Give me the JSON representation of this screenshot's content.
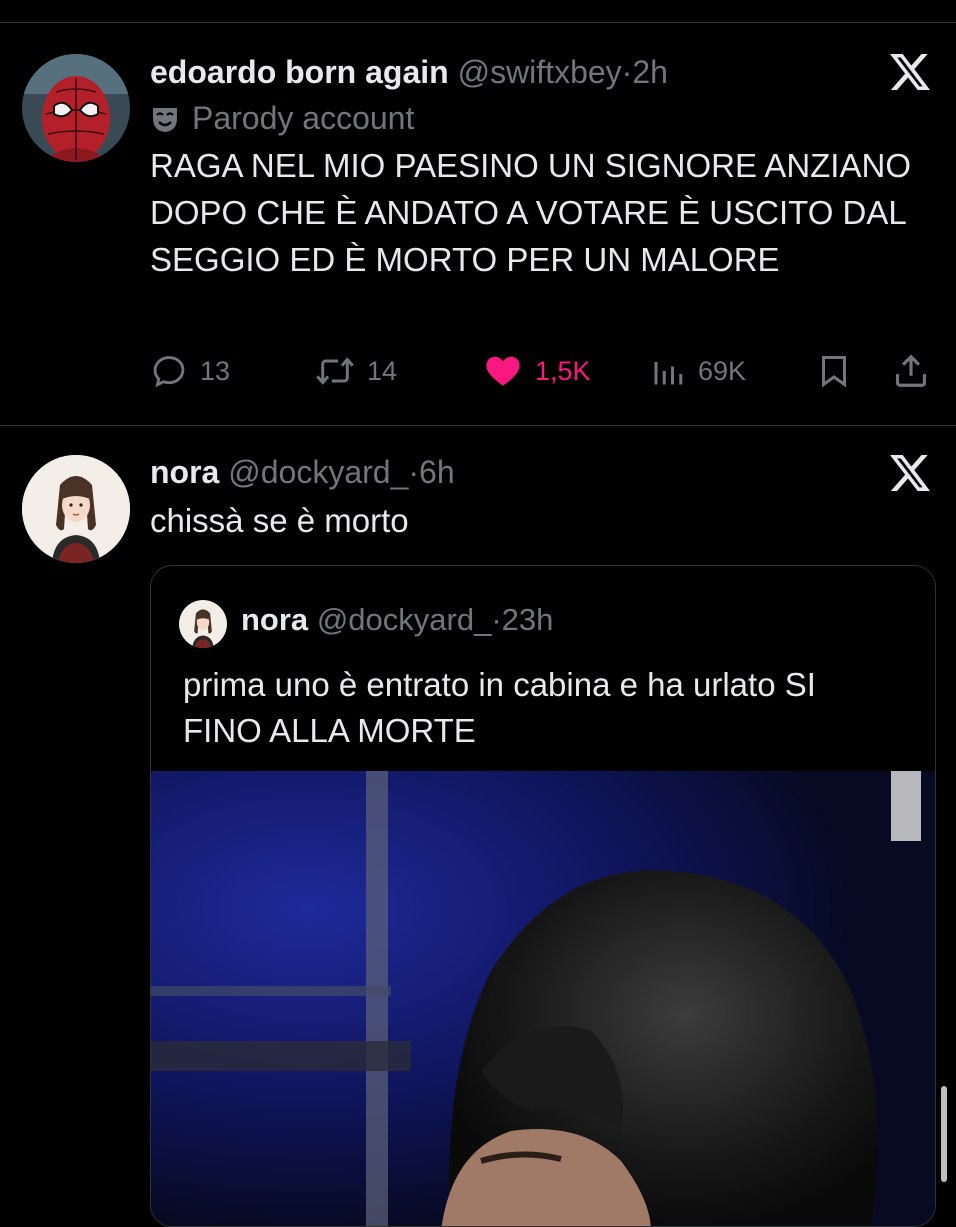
{
  "tweet1": {
    "display_name": "edoardo born again",
    "handle": "@swiftxbey",
    "dot": "·",
    "time": "2h",
    "label_icon": "theater-mask-icon",
    "label": "Parody account",
    "text": "RAGA NEL MIO PAESINO UN SIGNORE ANZIANO DOPO CHE È ANDATO A VOTARE È USCITO DAL SEGGIO ED È MORTO PER UN MALORE",
    "replies": "13",
    "reposts": "14",
    "likes": "1,5K",
    "views": "69K",
    "like_color": "#f91880"
  },
  "tweet2": {
    "display_name": "nora",
    "handle": "@dockyard_",
    "dot": "·",
    "time": "6h",
    "text": "chissà se è morto",
    "quote": {
      "display_name": "nora",
      "handle": "@dockyard_",
      "dot": "·",
      "time": "23h",
      "text": "prima uno è entrato in cabina e ha urlato SI FINO ALLA MORTE"
    }
  },
  "colors": {
    "background": "#000000",
    "text": "#e7e9ea",
    "secondary": "#71767b",
    "border": "#2f3336"
  }
}
